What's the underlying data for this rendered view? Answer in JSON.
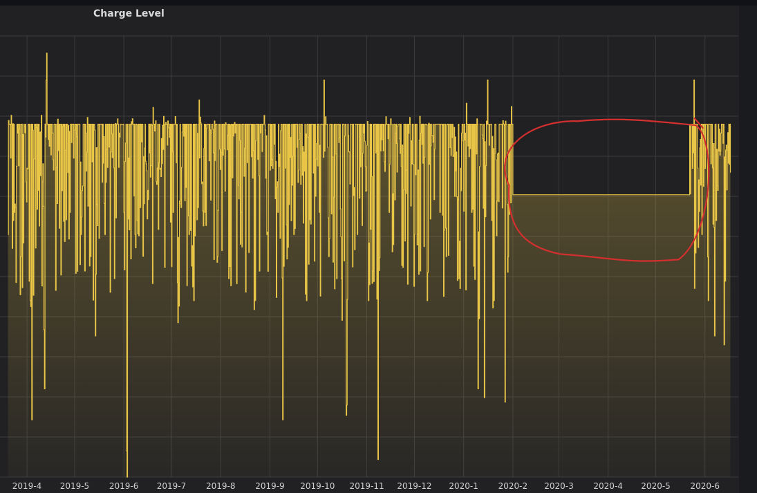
{
  "panel": {
    "title": "Charge Level"
  },
  "colors": {
    "series": "#e8c547",
    "annotation": "#d32f2f",
    "grid": "#3a3a3e",
    "tick_text": "#cfd0d2"
  },
  "chart_data": {
    "type": "area",
    "title": "Charge Level",
    "xlabel": "",
    "ylabel": "",
    "x_ticks": [
      "2019-4",
      "2019-5",
      "2019-6",
      "2019-7",
      "2019-8",
      "2019-9",
      "2019-10",
      "2019-11",
      "2019-12",
      "2020-1",
      "2020-2",
      "2020-3",
      "2020-4",
      "2020-5",
      "2020-6"
    ],
    "y_ticks_visible": false,
    "grid": true,
    "legend": "none",
    "series": [
      {
        "color": "#e8c547",
        "fill": "gradient",
        "points": [
          [
            "2019-03-20",
            55
          ],
          [
            "2019-03-22",
            82
          ],
          [
            "2019-03-24",
            60
          ],
          [
            "2019-03-26",
            78
          ],
          [
            "2019-03-28",
            50
          ],
          [
            "2019-03-30",
            80
          ],
          [
            "2019-04-01",
            70
          ],
          [
            "2019-04-03",
            40
          ],
          [
            "2019-04-04",
            13
          ],
          [
            "2019-04-06",
            80
          ],
          [
            "2019-04-08",
            65
          ],
          [
            "2019-04-10",
            82
          ],
          [
            "2019-04-12",
            20
          ],
          [
            "2019-04-13",
            90
          ],
          [
            "2019-04-15",
            75
          ],
          [
            "2019-04-17",
            78
          ],
          [
            "2019-04-20",
            62
          ],
          [
            "2019-04-24",
            58
          ],
          [
            "2019-04-28",
            60
          ],
          [
            "2019-05-02",
            80
          ],
          [
            "2019-05-05",
            55
          ],
          [
            "2019-05-08",
            78
          ],
          [
            "2019-05-11",
            50
          ],
          [
            "2019-05-14",
            32
          ],
          [
            "2019-05-17",
            80
          ],
          [
            "2019-05-20",
            55
          ],
          [
            "2019-05-23",
            80
          ],
          [
            "2019-05-26",
            45
          ],
          [
            "2019-05-29",
            78
          ],
          [
            "2019-06-01",
            60
          ],
          [
            "2019-06-03",
            0
          ],
          [
            "2019-06-05",
            80
          ],
          [
            "2019-06-08",
            55
          ],
          [
            "2019-06-12",
            76
          ],
          [
            "2019-06-16",
            65
          ],
          [
            "2019-06-20",
            80
          ],
          [
            "2019-06-24",
            70
          ],
          [
            "2019-06-28",
            80
          ],
          [
            "2019-07-02",
            60
          ],
          [
            "2019-07-05",
            35
          ],
          [
            "2019-07-08",
            80
          ],
          [
            "2019-07-12",
            55
          ],
          [
            "2019-07-15",
            40
          ],
          [
            "2019-07-18",
            80
          ],
          [
            "2019-07-22",
            60
          ],
          [
            "2019-07-26",
            78
          ],
          [
            "2019-07-30",
            50
          ],
          [
            "2019-08-02",
            80
          ],
          [
            "2019-08-06",
            45
          ],
          [
            "2019-08-10",
            78
          ],
          [
            "2019-08-14",
            60
          ],
          [
            "2019-08-18",
            80
          ],
          [
            "2019-08-22",
            38
          ],
          [
            "2019-08-26",
            78
          ],
          [
            "2019-08-30",
            55
          ],
          [
            "2019-09-03",
            80
          ],
          [
            "2019-09-06",
            60
          ],
          [
            "2019-09-09",
            13
          ],
          [
            "2019-09-12",
            80
          ],
          [
            "2019-09-16",
            55
          ],
          [
            "2019-09-20",
            78
          ],
          [
            "2019-09-24",
            40
          ],
          [
            "2019-09-28",
            80
          ],
          [
            "2019-10-02",
            60
          ],
          [
            "2019-10-05",
            90
          ],
          [
            "2019-10-08",
            50
          ],
          [
            "2019-10-12",
            80
          ],
          [
            "2019-10-16",
            45
          ],
          [
            "2019-10-19",
            14
          ],
          [
            "2019-10-22",
            80
          ],
          [
            "2019-10-26",
            55
          ],
          [
            "2019-10-30",
            78
          ],
          [
            "2019-11-02",
            40
          ],
          [
            "2019-11-05",
            80
          ],
          [
            "2019-11-08",
            4
          ],
          [
            "2019-11-11",
            80
          ],
          [
            "2019-11-15",
            60
          ],
          [
            "2019-11-19",
            78
          ],
          [
            "2019-11-23",
            48
          ],
          [
            "2019-11-27",
            80
          ],
          [
            "2019-12-01",
            55
          ],
          [
            "2019-12-05",
            78
          ],
          [
            "2019-12-09",
            40
          ],
          [
            "2019-12-13",
            80
          ],
          [
            "2019-12-17",
            60
          ],
          [
            "2019-12-21",
            50
          ],
          [
            "2019-12-25",
            80
          ],
          [
            "2019-12-29",
            45
          ],
          [
            "2020-01-02",
            78
          ],
          [
            "2020-01-06",
            60
          ],
          [
            "2020-01-10",
            20
          ],
          [
            "2020-01-12",
            80
          ],
          [
            "2020-01-14",
            18
          ],
          [
            "2020-01-16",
            90
          ],
          [
            "2020-01-20",
            40
          ],
          [
            "2020-01-24",
            80
          ],
          [
            "2020-01-27",
            17
          ],
          [
            "2020-01-29",
            50
          ],
          [
            "2020-01-31",
            84
          ],
          [
            "2020-02-01",
            64
          ],
          [
            "2020-05-22",
            64
          ],
          [
            "2020-05-24",
            70
          ],
          [
            "2020-05-25",
            90
          ],
          [
            "2020-05-27",
            80
          ],
          [
            "2020-05-30",
            55
          ],
          [
            "2020-06-01",
            70
          ],
          [
            "2020-06-03",
            40
          ],
          [
            "2020-06-05",
            80
          ],
          [
            "2020-06-07",
            32
          ],
          [
            "2020-06-09",
            65
          ],
          [
            "2020-06-11",
            78
          ],
          [
            "2020-06-13",
            30
          ],
          [
            "2020-06-15",
            74
          ],
          [
            "2020-06-17",
            69
          ]
        ]
      }
    ],
    "annotations": [
      {
        "type": "hand-drawn-ellipse",
        "color": "#d32f2f",
        "x_range": [
          "2020-01-27",
          "2020-06-04"
        ],
        "y_range": [
          49,
          81
        ]
      }
    ]
  }
}
